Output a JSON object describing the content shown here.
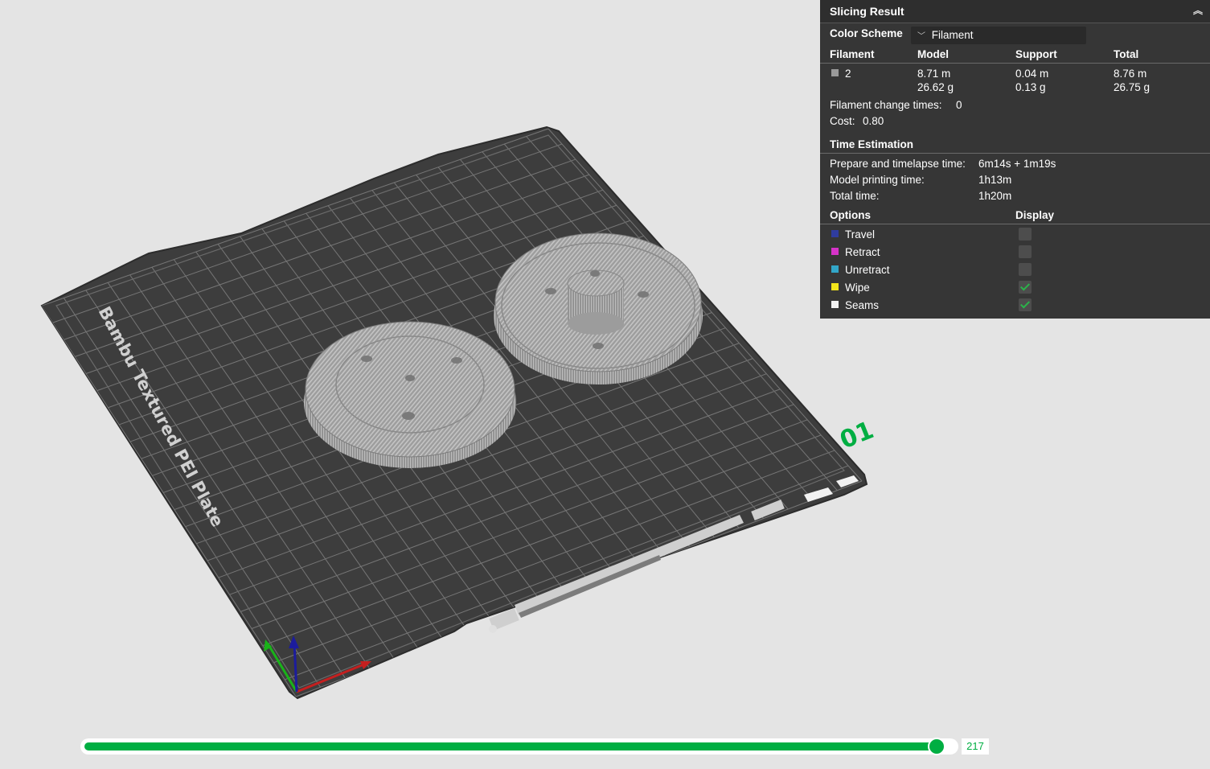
{
  "plate": {
    "brand_text": "Bambu Textured PEI Plate",
    "plate_number": "01",
    "colors": {
      "background": "#e4e4e4",
      "plate": "#3d3d3d",
      "grid": "#8a8a8a",
      "part": "#a8a8a8",
      "accent": "#00ae42"
    }
  },
  "panel": {
    "title": "Slicing Result",
    "color_scheme_label": "Color Scheme",
    "color_scheme_value": "Filament",
    "filament_table": {
      "headers": [
        "Filament",
        "Model",
        "Support",
        "Total"
      ],
      "row": {
        "filament": "2",
        "swatch_color": "#9a9a9a",
        "model_length": "8.71 m",
        "model_weight": "26.62 g",
        "support_length": "0.04 m",
        "support_weight": "0.13 g",
        "total_length": "8.76 m",
        "total_weight": "26.75 g"
      }
    },
    "filament_change_label": "Filament change times:",
    "filament_change_value": "0",
    "cost_label": "Cost:",
    "cost_value": "0.80",
    "time_estimation": {
      "title": "Time Estimation",
      "prepare_label": "Prepare and timelapse time:",
      "prepare_value": "6m14s + 1m19s",
      "model_label": "Model printing time:",
      "model_value": "1h13m",
      "total_label": "Total time:",
      "total_value": "1h20m"
    },
    "options": {
      "header_options": "Options",
      "header_display": "Display",
      "items": [
        {
          "label": "Travel",
          "color": "#2f3c9e",
          "checked": false
        },
        {
          "label": "Retract",
          "color": "#d633c9",
          "checked": false
        },
        {
          "label": "Unretract",
          "color": "#32a6c8",
          "checked": false
        },
        {
          "label": "Wipe",
          "color": "#f2e51b",
          "checked": true
        },
        {
          "label": "Seams",
          "color": "#f2f2f2",
          "checked": true
        }
      ]
    }
  },
  "layer_slider": {
    "value": "217",
    "fraction": 0.98
  }
}
